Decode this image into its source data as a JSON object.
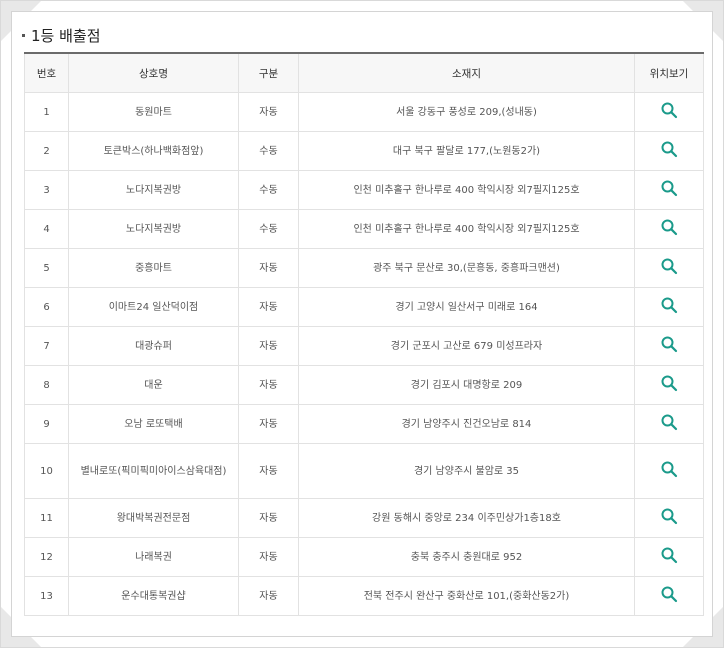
{
  "section": {
    "title": "1등 배출점"
  },
  "table": {
    "headers": {
      "no": "번호",
      "name": "상호명",
      "type": "구분",
      "address": "소재지",
      "view": "위치보기"
    },
    "rows": [
      {
        "no": "1",
        "name": "동원마트",
        "type": "자동",
        "address": "서울 강동구 풍성로 209,(성내동)"
      },
      {
        "no": "2",
        "name": "토큰박스(하나백화점앞)",
        "type": "수동",
        "address": "대구 북구 팔달로 177,(노원동2가)"
      },
      {
        "no": "3",
        "name": "노다지복권방",
        "type": "수동",
        "address": "인천 미추홀구 한나루로 400 학익시장 외7필지125호"
      },
      {
        "no": "4",
        "name": "노다지복권방",
        "type": "수동",
        "address": "인천 미추홀구 한나루로 400 학익시장 외7필지125호"
      },
      {
        "no": "5",
        "name": "중흥마트",
        "type": "자동",
        "address": "광주 북구 문산로 30,(문흥동, 중흥파크맨션)"
      },
      {
        "no": "6",
        "name": "이마트24 일산덕이점",
        "type": "자동",
        "address": "경기 고양시 일산서구 미래로 164"
      },
      {
        "no": "7",
        "name": "대광슈퍼",
        "type": "자동",
        "address": "경기 군포시 고산로 679 미성프라자"
      },
      {
        "no": "8",
        "name": "대운",
        "type": "자동",
        "address": "경기 김포시 대명항로 209"
      },
      {
        "no": "9",
        "name": "오남 로또택배",
        "type": "자동",
        "address": "경기 남양주시 진건오남로 814"
      },
      {
        "no": "10",
        "name": "별내로또(픽미픽미아이스삼육대점)",
        "type": "자동",
        "address": "경기 남양주시 불암로 35"
      },
      {
        "no": "11",
        "name": "왕대박복권전문점",
        "type": "자동",
        "address": "강원 동해시 중앙로 234 이주민상가1층18호"
      },
      {
        "no": "12",
        "name": "나래복권",
        "type": "자동",
        "address": "충북 충주시 충원대로 952"
      },
      {
        "no": "13",
        "name": "운수대통복권샵",
        "type": "자동",
        "address": "전북 전주시 완산구 중화산로 101,(중화산동2가)"
      }
    ]
  },
  "icon": {
    "name": "search-icon",
    "color": "#1a9a8a"
  }
}
